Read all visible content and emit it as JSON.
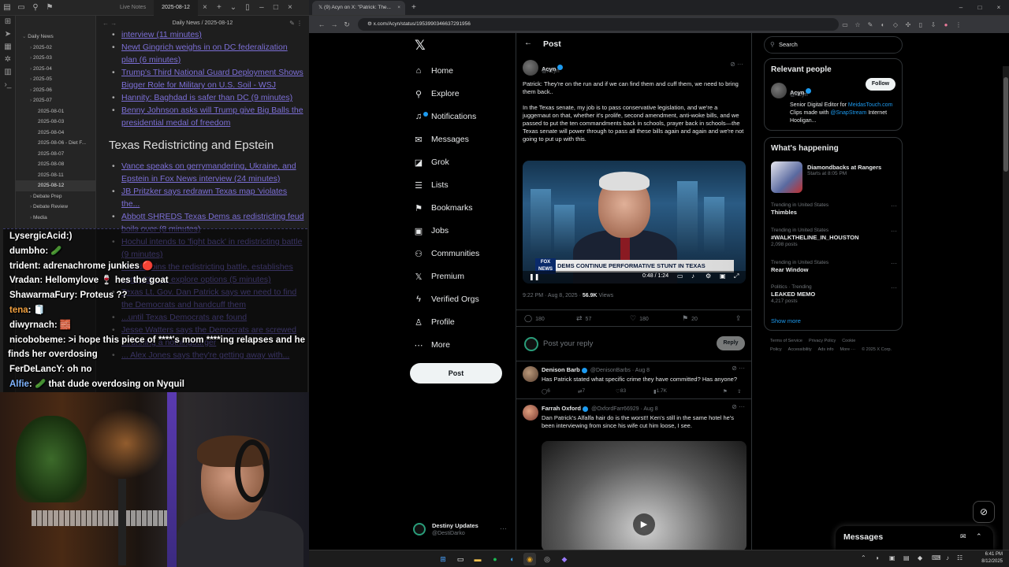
{
  "obsidian": {
    "tabs": [
      "Live Notes",
      "2025-08-12"
    ],
    "breadcrumb": "Daily News / 2025-08-12",
    "sidebar": [
      {
        "label": "Daily News",
        "depth": 0,
        "open": true
      },
      {
        "label": "2025-02",
        "depth": 1
      },
      {
        "label": "2025-03",
        "depth": 1
      },
      {
        "label": "2025-04",
        "depth": 1
      },
      {
        "label": "2025-05",
        "depth": 1
      },
      {
        "label": "2025-06",
        "depth": 1
      },
      {
        "label": "2025-07",
        "depth": 1
      },
      {
        "label": "2025-08-01",
        "depth": 2
      },
      {
        "label": "2025-08-03",
        "depth": 2
      },
      {
        "label": "2025-08-04",
        "depth": 2
      },
      {
        "label": "2025-08-06 - Diet F...",
        "depth": 2
      },
      {
        "label": "2025-08-07",
        "depth": 2
      },
      {
        "label": "2025-08-08",
        "depth": 2
      },
      {
        "label": "2025-08-11",
        "depth": 2
      },
      {
        "label": "2025-08-12",
        "depth": 2,
        "selected": true
      },
      {
        "label": "Debate Prep",
        "depth": 1
      },
      {
        "label": "Debate Review",
        "depth": 1
      },
      {
        "label": "Media",
        "depth": 1
      }
    ],
    "items_top": [
      "interview (11 minutes)",
      "Newt Gingrich weighs in on DC federalization plan (6 minutes)",
      "Trump's Third National Guard Deployment Shows Bigger Role for Military on U.S. Soil - WSJ",
      "Hannity: Baghdad is safer than DC (9 minutes)",
      "Benny Johnson asks will Trump give Big Balls the presidential medal of freedom"
    ],
    "heading": "Texas Redistricting and Epstein",
    "items_bottom": [
      "Vance speaks on gerrymandering, Ukraine, and Epstein in Fox News interview (24 minutes)",
      "JB Pritzker says redrawn Texas map 'violates the...",
      "Abbott SHREDS Texas Dems as redistricting feud boils over (8 minutes)",
      "Hochul intends to 'fight back' in redistricting battle (9 minutes)",
      "Florida joins the redistricting battle, establishes committee to explore options (5 minutes)",
      "Texas Lt. Gov. Dan Patrick says we need to find the Democrats and handcuff them",
      "...until Texas Democrats are found",
      "Jesse Watters says the Democrats are screwed",
      "...running a nothingburger",
      "... Alex Jones says they're getting away with..."
    ]
  },
  "chat": [
    {
      "user": "LysergicAcid",
      "color": "#ffffff",
      "msg": ":)"
    },
    {
      "user": "dumbho",
      "color": "#ffffff",
      "msg": ": 🥒"
    },
    {
      "user": "trident",
      "color": "#ffffff",
      "msg": ": adrenachrome junkies 🔴"
    },
    {
      "user": "Vradan",
      "color": "#ffffff",
      "msg": ": Hellomylove 🍷 hes the goat"
    },
    {
      "user": "ShawarmaFury",
      "color": "#ffffff",
      "msg": ": Proteus ??"
    },
    {
      "user": "tena",
      "color": "#f0a040",
      "msg": ": 🧻"
    },
    {
      "user": "diwyrnach",
      "color": "#ffffff",
      "msg": ": 🧱"
    },
    {
      "user": "nicobobeme",
      "color": "#ffffff",
      "msg": ": >i hope this piece of ****'s mom ****ing relapses and he"
    },
    {
      "user": "",
      "color": "#ffffff",
      "msg": "finds her overdosing"
    },
    {
      "user": "FerDeLancY",
      "color": "#ffffff",
      "msg": ": oh no"
    },
    {
      "user": "Alfie",
      "color": "#7fb4ff",
      "msg": ": 🥒 that dude overdosing on Nyquil"
    }
  ],
  "browser": {
    "tab_title": "(9) Acyn on X: \"Patrick: The...",
    "url": "x.com/Acyn/status/1953990346637291956"
  },
  "x": {
    "nav": [
      {
        "label": "Home",
        "icon": "home-icon",
        "glyph": "⌂"
      },
      {
        "label": "Explore",
        "icon": "search-icon",
        "glyph": "⚲"
      },
      {
        "label": "Notifications",
        "icon": "bell-icon",
        "glyph": "♫"
      },
      {
        "label": "Messages",
        "icon": "mail-icon",
        "glyph": "✉"
      },
      {
        "label": "Grok",
        "icon": "grok-icon",
        "glyph": "◪"
      },
      {
        "label": "Lists",
        "icon": "list-icon",
        "glyph": "☰"
      },
      {
        "label": "Bookmarks",
        "icon": "bookmark-icon",
        "glyph": "⚑"
      },
      {
        "label": "Jobs",
        "icon": "briefcase-icon",
        "glyph": "▣"
      },
      {
        "label": "Communities",
        "icon": "people-icon",
        "glyph": "⚇"
      },
      {
        "label": "Premium",
        "icon": "x-logo-icon",
        "glyph": "𝕏"
      },
      {
        "label": "Verified Orgs",
        "icon": "lightning-icon",
        "glyph": "ϟ"
      },
      {
        "label": "Profile",
        "icon": "person-icon",
        "glyph": "♙"
      },
      {
        "label": "More",
        "icon": "more-circle-icon",
        "glyph": "⋯"
      }
    ],
    "post_button": "Post",
    "account": {
      "name": "Destiny Updates",
      "handle": "@DestiDarko"
    },
    "header_title": "Post",
    "tweet": {
      "name": "Acyn",
      "handle": "@Acyn",
      "text_1": "Patrick: They're on the run and if we can find them and cuff them, we need to bring them back..",
      "text_2": "In the Texas senate, my job is to pass conservative legislation, and we're a juggernaut on that, whether it's prolife, second amendment, anti-woke bills, and we passed to put the ten commandments back in schools, prayer back in schools—the Texas senate will power through to pass all these bills again and again and we're not going to put up with this.",
      "chyron": "DEMS CONTINUE PERFORMATIVE STUNT IN TEXAS",
      "fox_logo": "FOX NEWS",
      "video_time": "0:48 / 1:24",
      "time": "9:22 PM · Aug 8, 2025 · ",
      "views": "56.9K",
      "views_label": " Views",
      "replies": "180",
      "reposts": "57",
      "likes": "180",
      "bookmarks": "20"
    },
    "reply_placeholder": "Post your reply",
    "reply_button": "Reply",
    "replies": [
      {
        "name": "Denison Barb",
        "handle": "@DenisonBarbs · Aug 8",
        "text": "Has Patrick stated what specific crime they have committed? Has anyone?",
        "replies": "6",
        "reposts": "7",
        "likes": "83",
        "views": "1.7K"
      },
      {
        "name": "Farrah Oxford",
        "handle": "@OxfordFarr66929 · Aug 8",
        "text": "Dan Patrick's Alfalfa hair do is the worst!! Ken's still in the same hotel he's been interviewing from since his wife cut him loose, I see."
      }
    ],
    "search_placeholder": "Search",
    "relevant": {
      "title": "Relevant people",
      "name": "Acyn",
      "handle": "@Acyn",
      "follow": "Follow",
      "bio_1": "Senior Digital Editor for ",
      "bio_link_1": "MeidasTouch.com",
      "bio_2": " Clips made with ",
      "bio_link_2": "@SnapStream",
      "bio_3": " Internet Hooligan..."
    },
    "happening": {
      "title": "What's happening",
      "event_name": "Diamondbacks at Rangers",
      "event_time": "Starts at 8:05 PM",
      "trends": [
        {
          "cat": "Trending in United States",
          "name": "Thimbles",
          "count": ""
        },
        {
          "cat": "Trending in United States",
          "name": "#WALKTHELINE_IN_HOUSTON",
          "count": "2,098 posts"
        },
        {
          "cat": "Trending in United States",
          "name": "Rear Window",
          "count": ""
        },
        {
          "cat": "Politics · Trending",
          "name": "LEAKED MEMO",
          "count": "4,217 posts"
        }
      ],
      "show_more": "Show more"
    },
    "footer": [
      "Terms of Service",
      "Privacy Policy",
      "Cookie Policy",
      "Accessibility",
      "Ads info",
      "More ···",
      "© 2025 X Corp."
    ],
    "messages_drawer": "Messages"
  },
  "taskbar": {
    "time": "6:41 PM",
    "date": "8/12/2025"
  }
}
